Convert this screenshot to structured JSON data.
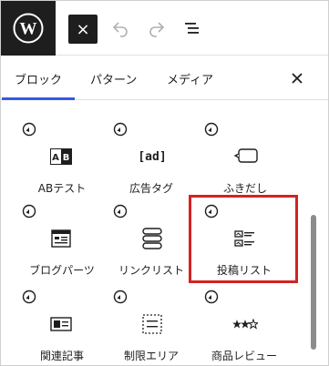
{
  "toolbar": {
    "logo": "wordpress-logo",
    "close_label": "×"
  },
  "tabs": [
    {
      "label": "ブロック",
      "active": true
    },
    {
      "label": "パターン",
      "active": false
    },
    {
      "label": "メディア",
      "active": false
    }
  ],
  "tab_close_label": "×",
  "blocks": [
    {
      "label": "ABテスト",
      "icon": "ab-test-icon"
    },
    {
      "label": "広告タグ",
      "icon": "ad-tag-icon",
      "icon_text": "[ad]"
    },
    {
      "label": "ふきだし",
      "icon": "speech-bubble-icon"
    },
    {
      "label": "ブログパーツ",
      "icon": "blog-parts-icon"
    },
    {
      "label": "リンクリスト",
      "icon": "link-list-icon"
    },
    {
      "label": "投稿リスト",
      "icon": "post-list-icon",
      "highlighted": true
    },
    {
      "label": "関連記事",
      "icon": "related-posts-icon"
    },
    {
      "label": "制限エリア",
      "icon": "restricted-area-icon"
    },
    {
      "label": "商品レビュー",
      "icon": "product-review-icon"
    }
  ],
  "colors": {
    "accent": "#3858e9",
    "highlight": "#d32222",
    "dark": "#1e1e1e"
  }
}
